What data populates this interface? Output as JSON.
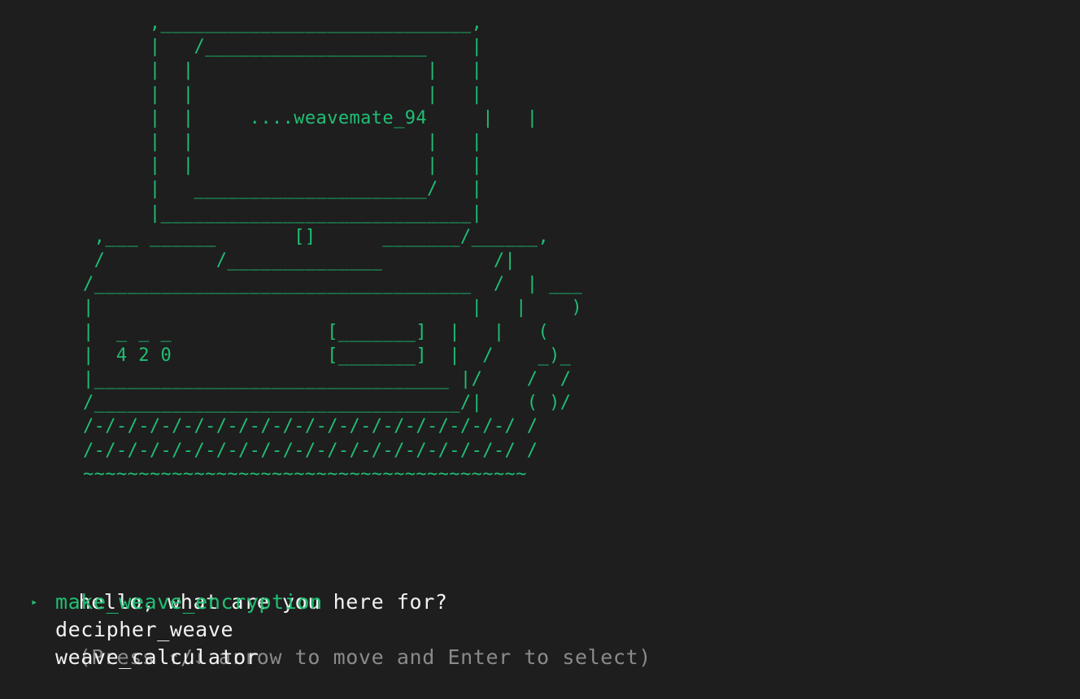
{
  "ascii_art": "      ,____________________________,\n      |   /____________________    |\n      |  |                     |   |\n      |  |                     |   |\n      |  |     ....weavemate_94     |   |\n      |  |                     |   |\n      |  |                     |   |\n      |   _____________________/   |\n      |____________________________|\n ,___ ______       []      _______/______,\n /          /______________          /|\n/__________________________________  /  | ___\n|                                  |   |    )\n|  _ _ _              [_______]  |   |   (\n|  4 2 0              [_______]  |  /    _)_\n|________________________________ |/    /  /\n/_________________________________/|    ( )/\n/-/-/-/-/-/-/-/-/-/-/-/-/-/-/-/-/-/-/-/ /\n/-/-/-/-/-/-/-/-/-/-/-/-/-/-/-/-/-/-/-/ /\n~~~~~~~~~~~~~~~~~~~~~~~~~~~~~~~~~~~~~~~~",
  "prompt": {
    "question": "hello, what are you here for?",
    "hint": "(Press ↑/↓ arrow to move and Enter to select)"
  },
  "menu": {
    "pointer": "▸",
    "items": [
      {
        "label": "make_weave_encryption",
        "selected": true
      },
      {
        "label": "decipher_weave",
        "selected": false
      },
      {
        "label": "weave_calculator",
        "selected": false
      }
    ]
  },
  "colors": {
    "background": "#1e1e1e",
    "accent_green": "#1fbf73",
    "text": "#f2f2f2",
    "hint": "#8a8a8a"
  }
}
